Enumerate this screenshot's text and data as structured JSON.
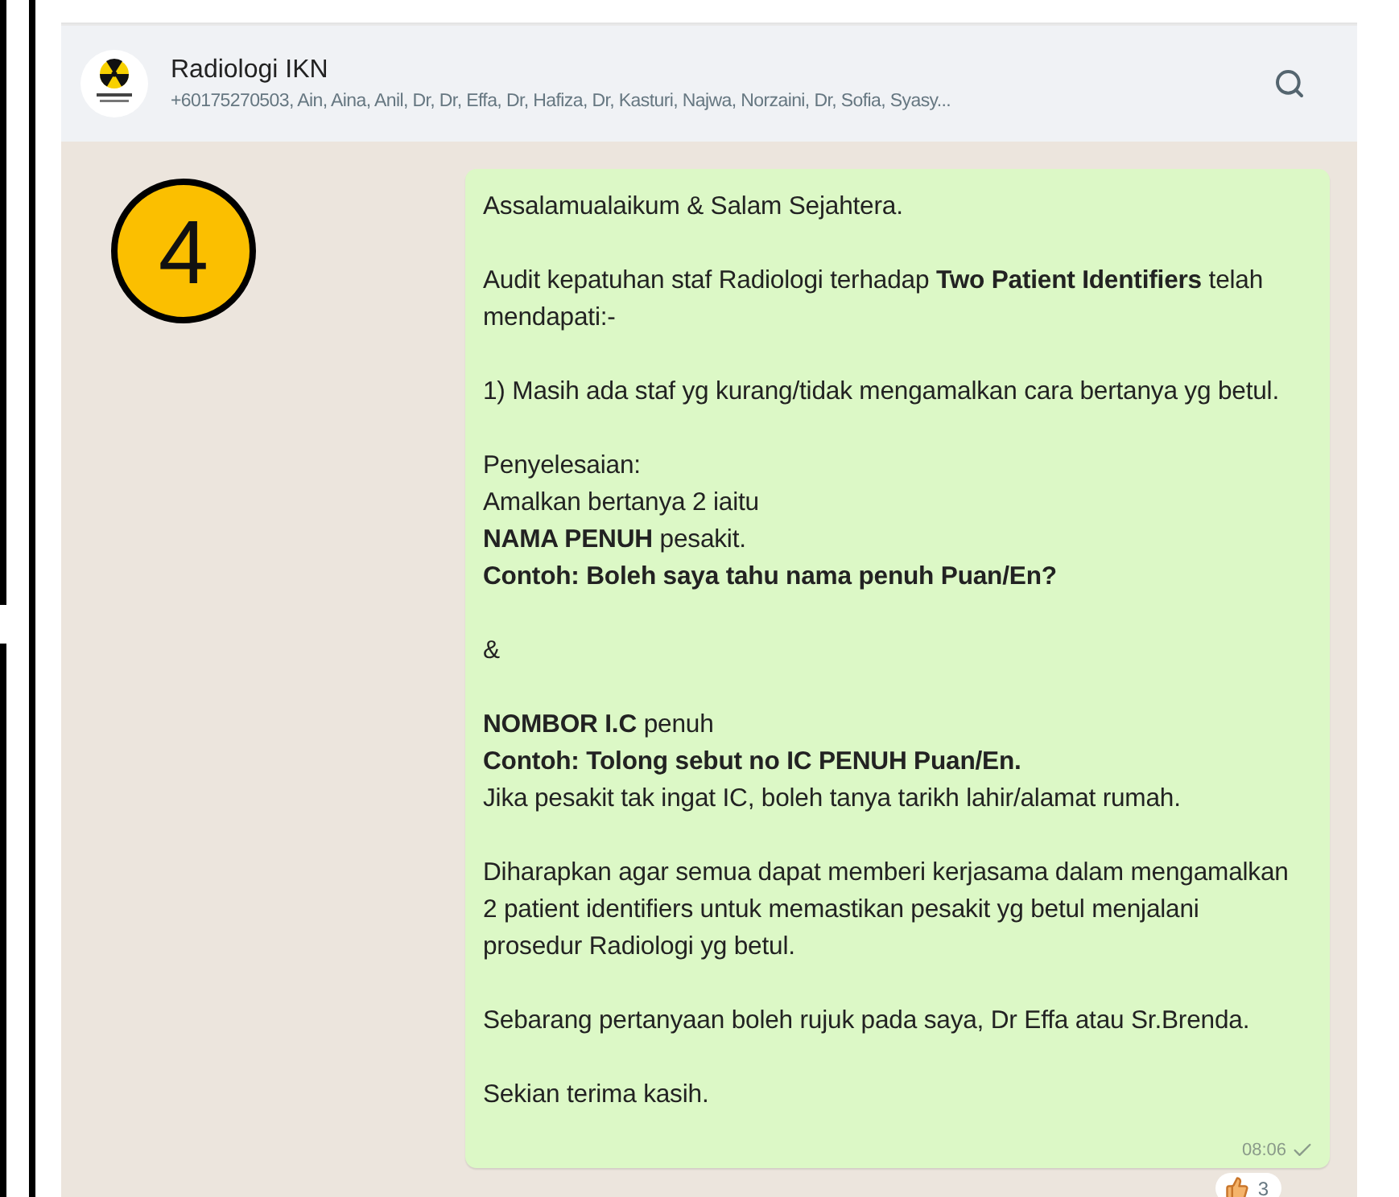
{
  "step_badge": "4",
  "chat": {
    "title": "Radiologi IKN",
    "participants": "+60175270503, Ain, Aina, Anil, Dr, Dr, Effa, Dr, Hafiza, Dr, Kasturi, Najwa, Norzaini, Dr, Sofia, Syasy..."
  },
  "message": {
    "paragraphs": [
      [
        "Assalamualaikum & Salam Sejahtera."
      ],
      [
        "Audit kepatuhan staf Radiologi terhadap **Two Patient Identifiers** telah mendapati:-"
      ],
      [
        "1) Masih ada staf yg kurang/tidak mengamalkan cara bertanya yg betul."
      ],
      [
        "Penyelesaian:",
        "Amalkan bertanya 2 iaitu",
        "**NAMA PENUH** pesakit.",
        "**Contoh: Boleh saya tahu nama penuh Puan/En?**"
      ],
      [
        "&"
      ],
      [
        "**NOMBOR I.C** penuh",
        "**Contoh: Tolong sebut no IC PENUH Puan/En.**",
        "Jika pesakit tak ingat IC, boleh tanya tarikh lahir/alamat rumah."
      ],
      [
        "Diharapkan agar semua dapat memberi kerjasama dalam mengamalkan 2 patient identifiers untuk memastikan pesakit yg betul menjalani prosedur Radiologi yg betul."
      ],
      [
        "Sebarang pertanyaan boleh rujuk pada saya, Dr Effa atau Sr.Brenda."
      ],
      [
        "Sekian terima kasih."
      ]
    ],
    "time": "08:06",
    "delivered": true,
    "reaction": {
      "count": "3"
    }
  }
}
